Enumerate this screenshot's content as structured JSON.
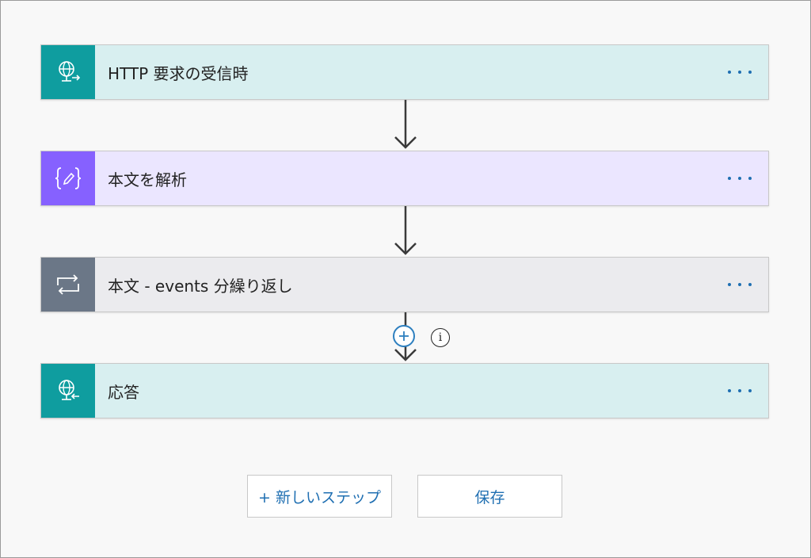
{
  "flow": {
    "steps": [
      {
        "title": "HTTP 要求の受信時",
        "icon": "http-request-globe-icon",
        "icon_color": "#0f9d9f",
        "card_color": "#d8eff0"
      },
      {
        "title": "本文を解析",
        "icon": "parse-json-icon",
        "icon_color": "#8661ff",
        "card_color": "#ebe6ff"
      },
      {
        "title": "本文 - events 分繰り返し",
        "icon": "loop-icon",
        "icon_color": "#6b7787",
        "card_color": "#ebebee"
      },
      {
        "title": "応答",
        "icon": "response-globe-icon",
        "icon_color": "#0f9d9f",
        "card_color": "#d8eff0"
      }
    ],
    "more_label": "···",
    "add_symbol": "+",
    "info_symbol": "i"
  },
  "actions": {
    "new_step_label": "+ 新しいステップ",
    "save_label": "保存"
  },
  "colors": {
    "accent": "#1f6fb2",
    "connector": "#3a3a3a"
  }
}
